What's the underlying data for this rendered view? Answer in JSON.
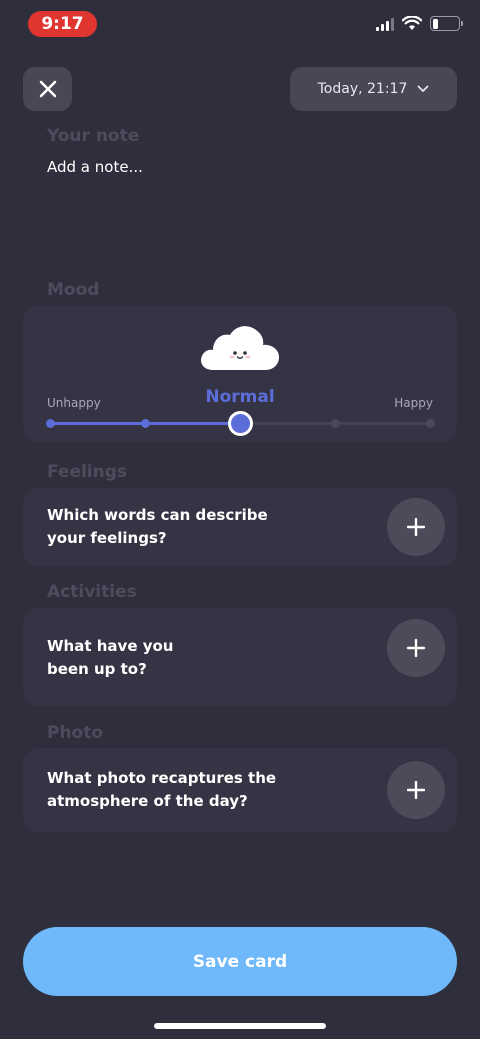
{
  "status_bar": {
    "time": "9:17",
    "battery_level": 0.22
  },
  "header": {
    "date_label": "Today, 21:17"
  },
  "note": {
    "label": "Your note",
    "placeholder": "Add a note..."
  },
  "mood": {
    "label": "Mood",
    "selected": "Normal",
    "left_label": "Unhappy",
    "right_label": "Happy",
    "steps": 5,
    "selected_index": 2,
    "accent": "#5c6cd8"
  },
  "feelings": {
    "label": "Feelings",
    "prompt_line1": "Which words can describe",
    "prompt_line2": "your feelings?"
  },
  "activities": {
    "label": "Activities",
    "prompt_line1": "What have you",
    "prompt_line2": "been up to?"
  },
  "photo": {
    "label": "Photo",
    "prompt_line1": "What photo recaptures the",
    "prompt_line2": "atmosphere of the day?"
  },
  "save": {
    "label": "Save card",
    "color": "#6fb8f9"
  },
  "icons": {
    "close": "close-icon",
    "chevron": "chevron-down-icon",
    "plus": "plus-icon"
  }
}
